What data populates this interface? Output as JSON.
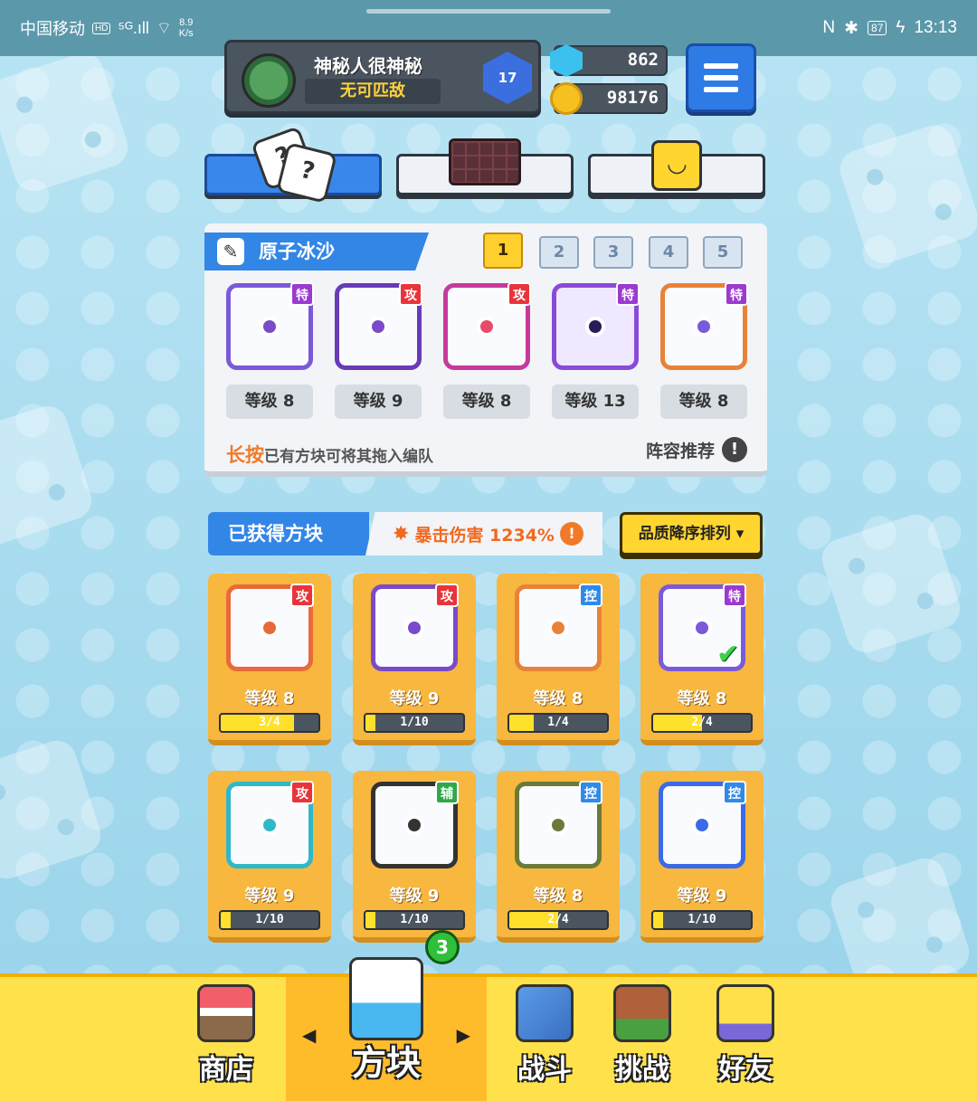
{
  "status_bar": {
    "carrier": "中国移动",
    "hd": "HD",
    "signal": "⁵ᴳ.ıll",
    "speed_value": "8.9",
    "speed_unit": "K/s",
    "battery": "87",
    "time": "13:13"
  },
  "player": {
    "name": "神秘人很神秘",
    "status": "无可匹敌",
    "level": "17"
  },
  "currency": {
    "gems": "862",
    "coins": "98176"
  },
  "deck": {
    "title": "原子冰沙",
    "slots": [
      "1",
      "2",
      "3",
      "4",
      "5"
    ],
    "cards": [
      {
        "badge": "特",
        "level": "等级 8"
      },
      {
        "badge": "攻",
        "level": "等级 9"
      },
      {
        "badge": "攻",
        "level": "等级 8"
      },
      {
        "badge": "特",
        "level": "等级 13"
      },
      {
        "badge": "特",
        "level": "等级 8"
      }
    ],
    "hint_highlight": "长按",
    "hint_text": "已有方块可将其拖入编队",
    "recommend": "阵容推荐",
    "recommend_icon": "!"
  },
  "collection": {
    "title": "已获得方块",
    "crit_text": "暴击伤害 1234%",
    "crit_info": "!",
    "sort_label": "品质降序排列",
    "sort_arrow": "▾",
    "cards": [
      {
        "badge": "攻",
        "level": "等级 8",
        "progress": "3/4",
        "ratio": 0.75,
        "color": "#e86a3a",
        "equipped": false
      },
      {
        "badge": "攻",
        "level": "等级 9",
        "progress": "1/10",
        "ratio": 0.1,
        "color": "#7a4ac8",
        "equipped": false
      },
      {
        "badge": "控",
        "level": "等级 8",
        "progress": "1/4",
        "ratio": 0.25,
        "color": "#e8823a",
        "equipped": false
      },
      {
        "badge": "特",
        "level": "等级 8",
        "progress": "2/4",
        "ratio": 0.5,
        "color": "#7a5ad8",
        "equipped": true
      },
      {
        "badge": "攻",
        "level": "等级 9",
        "progress": "1/10",
        "ratio": 0.1,
        "color": "#2fb8c8",
        "equipped": false
      },
      {
        "badge": "辅",
        "level": "等级 9",
        "progress": "1/10",
        "ratio": 0.1,
        "color": "#333333",
        "equipped": false
      },
      {
        "badge": "控",
        "level": "等级 8",
        "progress": "2/4",
        "ratio": 0.5,
        "color": "#6a7a3a",
        "equipped": false
      },
      {
        "badge": "控",
        "level": "等级 9",
        "progress": "1/10",
        "ratio": 0.1,
        "color": "#3a6ae8",
        "equipped": false
      }
    ]
  },
  "bottom_nav": {
    "shop": "商店",
    "blocks": "方块",
    "battle": "战斗",
    "challenge": "挑战",
    "friends": "好友",
    "blocks_badge": "3",
    "arrow_left": "◀",
    "arrow_right": "▶"
  },
  "colors": {
    "badge_attack": "#e8343a",
    "badge_special": "#9b3ad0",
    "badge_control": "#2f8ae8",
    "badge_support": "#2fa84a",
    "accent_blue": "#3286e6",
    "accent_yellow": "#ffd530"
  }
}
